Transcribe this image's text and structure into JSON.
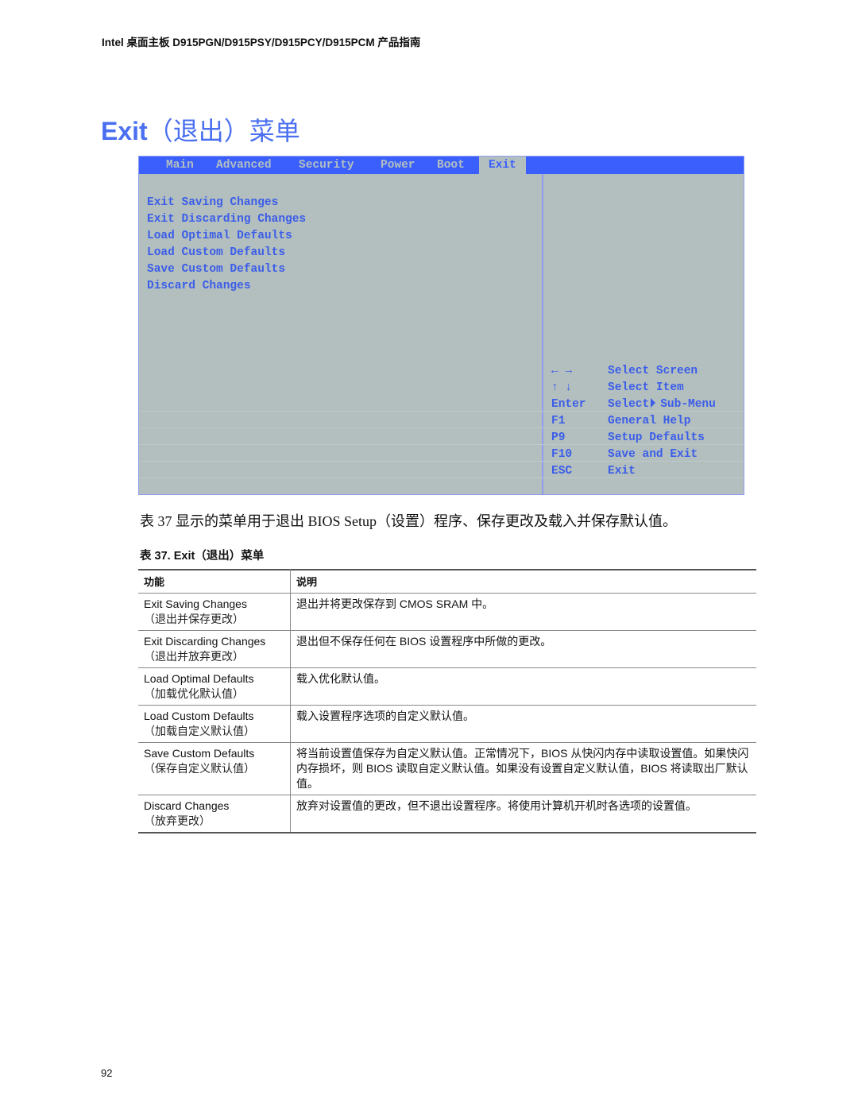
{
  "header": {
    "running_title": "Intel 桌面主板 D915PGN/D915PSY/D915PCY/D915PCM 产品指南"
  },
  "page_title": {
    "latin": "Exit",
    "cjk": "（退出）菜单"
  },
  "bios": {
    "tabs": [
      {
        "label": "Main",
        "active": false
      },
      {
        "label": "Advanced",
        "active": false
      },
      {
        "label": "Security",
        "active": false
      },
      {
        "label": "Power",
        "active": false
      },
      {
        "label": "Boot",
        "active": false
      },
      {
        "label": "Exit",
        "active": true
      }
    ],
    "menu_items": [
      "Exit Saving Changes",
      "Exit Discarding Changes",
      "Load Optimal Defaults",
      "Load Custom Defaults",
      "Save Custom Defaults",
      "Discard Changes"
    ],
    "key_help": [
      {
        "key": "← →",
        "action": "Select Screen"
      },
      {
        "key": "↑ ↓",
        "action": "Select Item"
      },
      {
        "key": "Enter",
        "action_before": "Select",
        "action_after": "Sub-Menu",
        "icon": "triangle-right-icon"
      },
      {
        "key": "F1",
        "action": "General Help"
      },
      {
        "key": "P9",
        "action": "Setup Defaults"
      },
      {
        "key": "F10",
        "action": "Save and Exit"
      },
      {
        "key": "ESC",
        "action": "Exit"
      }
    ],
    "colors": {
      "menubar": "#3a5ffd",
      "background": "#b3bfbf",
      "text": "#3b5de8"
    }
  },
  "intro_text": "表 37 显示的菜单用于退出 BIOS Setup（设置）程序、保存更改及载入并保存默认值。",
  "table": {
    "caption": "表 37.   Exit（退出）菜单",
    "headers": [
      "功能",
      "说明"
    ],
    "rows": [
      {
        "feature": "Exit Saving Changes",
        "feature_cn": "（退出并保存更改）",
        "description": "退出并将更改保存到 CMOS SRAM 中。"
      },
      {
        "feature": "Exit Discarding Changes",
        "feature_cn": "（退出并放弃更改）",
        "description": "退出但不保存任何在 BIOS 设置程序中所做的更改。"
      },
      {
        "feature": "Load Optimal Defaults",
        "feature_cn": "（加载优化默认值）",
        "description": "载入优化默认值。"
      },
      {
        "feature": "Load Custom Defaults",
        "feature_cn": "（加载自定义默认值）",
        "description": "载入设置程序选项的自定义默认值。"
      },
      {
        "feature": "Save Custom Defaults",
        "feature_cn": "（保存自定义默认值）",
        "description": "将当前设置值保存为自定义默认值。正常情况下，BIOS 从快闪内存中读取设置值。如果快闪内存损坏，则 BIOS 读取自定义默认值。如果没有设置自定义默认值，BIOS 将读取出厂默认值。"
      },
      {
        "feature": "Discard Changes",
        "feature_cn": "（放弃更改）",
        "description": "放弃对设置值的更改，但不退出设置程序。将使用计算机开机时各选项的设置值。"
      }
    ]
  },
  "page_number": "92"
}
